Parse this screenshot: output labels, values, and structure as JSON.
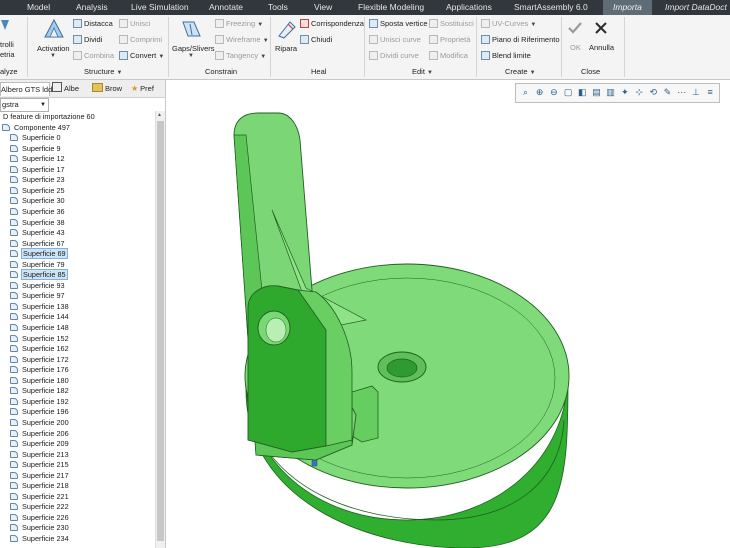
{
  "tabs": {
    "model": "Model",
    "analysis": "Analysis",
    "live_simulation": "Live Simulation",
    "annotate": "Annotate",
    "tools": "Tools",
    "view": "View",
    "flexible_modeling": "Flexible Modeling",
    "applications": "Applications",
    "smartassembly": "SmartAssembly 6.0",
    "importa": "Importa",
    "import_datadoctor": "Import DataDoct"
  },
  "ribbon": {
    "partial_left_top": "trolli",
    "partial_left_bottom": "etria",
    "activation": "Activation",
    "distacca": "Distacca",
    "dividi": "Dividi",
    "combina": "Combina",
    "unisci": "Unisci",
    "comprimi": "Comprimi",
    "converti": "Convert",
    "gaps_slivers": "Gaps/Slivers",
    "freezing": "Freezing",
    "wireframe": "Wireframe",
    "tangency": "Tangency",
    "ripara": "Ripara",
    "corrispondenza": "Corrispondenza",
    "chiudi": "Chiudi",
    "sposta_vertice": "Sposta vertice",
    "sostituisci": "Sostituisci",
    "unisci_curve": "Unisci curve",
    "proprieta": "Proprietà",
    "dividi_curve": "Dividi curve",
    "modifica": "Modifica",
    "uv_curves": "UV-Curves",
    "piano_riferimento": "Piano di Riferimento",
    "blend_limite": "Blend limite",
    "ok": "OK",
    "annulla": "Annulla",
    "groups": {
      "analyze": "alyze",
      "structure": "Structure",
      "constrain": "Constrain",
      "heal": "Heal",
      "edit": "Edit",
      "create": "Create",
      "close": "Close"
    }
  },
  "left_panel": {
    "tabs": [
      "Albero GTS ldd",
      "Albe",
      "Brow",
      "Pref"
    ],
    "combo_value": "gstra",
    "tree": [
      {
        "label": "D feature di importazione 60",
        "level": 0
      },
      {
        "label": "Componente 497",
        "level": 1
      },
      {
        "label": "Superficie 0",
        "level": 2
      },
      {
        "label": "Superficie 9",
        "level": 2
      },
      {
        "label": "Superficie 12",
        "level": 2
      },
      {
        "label": "Superficie 17",
        "level": 2
      },
      {
        "label": "Superficie 23",
        "level": 2
      },
      {
        "label": "Superficie 25",
        "level": 2
      },
      {
        "label": "Superficie 30",
        "level": 2
      },
      {
        "label": "Superficie 36",
        "level": 2
      },
      {
        "label": "Superficie 38",
        "level": 2
      },
      {
        "label": "Superficie 43",
        "level": 2
      },
      {
        "label": "Superficie 67",
        "level": 2
      },
      {
        "label": "Superficie 69",
        "level": 2,
        "highlighted": true
      },
      {
        "label": "Superficie 79",
        "level": 2
      },
      {
        "label": "Superficie 85",
        "level": 2,
        "highlighted": true
      },
      {
        "label": "Superficie 93",
        "level": 2
      },
      {
        "label": "Superficie 97",
        "level": 2
      },
      {
        "label": "Superficie 138",
        "level": 2
      },
      {
        "label": "Superficie 144",
        "level": 2
      },
      {
        "label": "Superficie 148",
        "level": 2
      },
      {
        "label": "Superficie 152",
        "level": 2
      },
      {
        "label": "Superficie 162",
        "level": 2
      },
      {
        "label": "Superficie 172",
        "level": 2
      },
      {
        "label": "Superficie 176",
        "level": 2
      },
      {
        "label": "Superficie 180",
        "level": 2
      },
      {
        "label": "Superficie 182",
        "level": 2
      },
      {
        "label": "Superficie 192",
        "level": 2
      },
      {
        "label": "Superficie 196",
        "level": 2
      },
      {
        "label": "Superficie 200",
        "level": 2
      },
      {
        "label": "Superficie 206",
        "level": 2
      },
      {
        "label": "Superficie 209",
        "level": 2
      },
      {
        "label": "Superficie 213",
        "level": 2
      },
      {
        "label": "Superficie 215",
        "level": 2
      },
      {
        "label": "Superficie 217",
        "level": 2
      },
      {
        "label": "Superficie 218",
        "level": 2
      },
      {
        "label": "Superficie 221",
        "level": 2
      },
      {
        "label": "Superficie 222",
        "level": 2
      },
      {
        "label": "Superficie 226",
        "level": 2
      },
      {
        "label": "Superficie 230",
        "level": 2
      },
      {
        "label": "Superficie 234",
        "level": 2
      }
    ]
  },
  "colors": {
    "model_fill": "#74d56f",
    "model_dark": "#2aa82a",
    "model_edge": "#1f5f1f",
    "selection": "#cce4f7",
    "tabbar": "#32373d"
  },
  "view_toolbar_icons": [
    "refit-icon",
    "zoom-in-icon",
    "zoom-out-icon",
    "repaint-icon",
    "display-style-icon",
    "saved-views-icon",
    "view-manager-icon",
    "datum-display-icon",
    "annotation-display-icon",
    "spin-center-icon",
    "plane-tags-icon",
    "point-tags-icon",
    "csys-icon",
    "model-tree-icon"
  ]
}
